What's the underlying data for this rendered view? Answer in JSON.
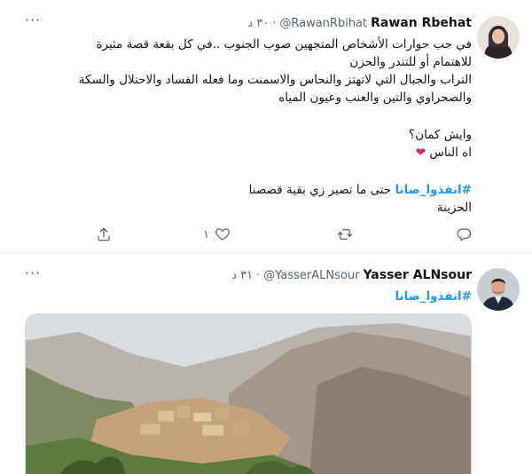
{
  "tweets": [
    {
      "name": "Rawan Rbehat",
      "handle": "@RawanRbihat",
      "time": "٣٠ د",
      "dot": "·",
      "lines": [
        "في حب حوارات الأشخاص المتجهين صوب الجنوب ..في كل بقعة قصة مثيرة",
        "للاهتمام أو للتندر والحزن",
        "التراب والجبال التي لاتهتز والنحاس والاسمنت وما فعله الفساد والاحتلال والسكة",
        "والصحراوي والتين والعنب وعيون المياه"
      ],
      "lines2": [
        "وايش كمان؟",
        "اه الناس"
      ],
      "hashtag": "#انقذوا_ضانا",
      "hashtag_rest": " حتى ما تصير زي بقية قصصنا",
      "last_line": "الحزينة",
      "like_count": "١",
      "heart_icon": "heart-icon"
    },
    {
      "name": "Yasser ALNsour",
      "handle": "@YasserALNsour",
      "time": "٣١ د",
      "dot": "·",
      "hashtag": "#انقذوا_ضانا"
    }
  ],
  "colors": {
    "accent": "#1d9bf0",
    "muted": "#536471",
    "heart": "#e0245e",
    "divider": "#eff3f4"
  },
  "icons": [
    "share-icon",
    "like-icon",
    "retweet-icon",
    "reply-icon",
    "more-icon"
  ]
}
